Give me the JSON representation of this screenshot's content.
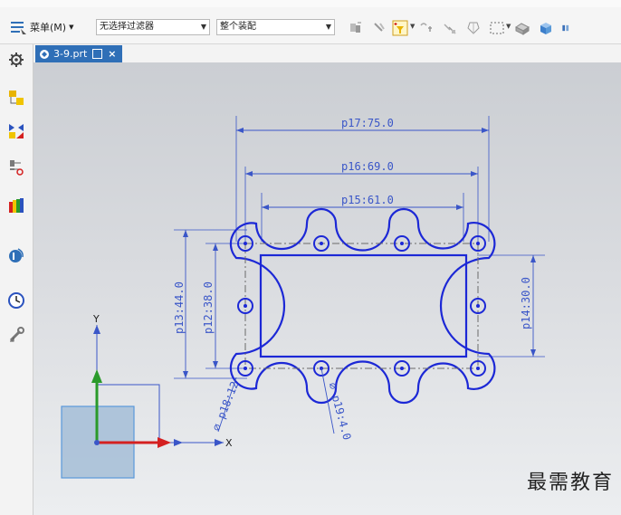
{
  "toolbar": {
    "menu_label": "菜单(M)",
    "filter_value": "无选择过滤器",
    "assembly_value": "整个装配"
  },
  "sidebar": {
    "items": [
      "gear-icon",
      "part-navigator-icon",
      "assembly-navigator-icon",
      "constraint-navigator-icon",
      "reuse-library-icon",
      "web-browser-icon",
      "history-icon",
      "role-icon"
    ]
  },
  "tab": {
    "label": "3-9.prt"
  },
  "drawing": {
    "dims": {
      "p17": "p17:75.0",
      "p16": "p16:69.0",
      "p15": "p15:61.0",
      "p13": "p13:44.0",
      "p12": "p12:38.0",
      "p14": "p14:30.0",
      "p18": "⌀ p18:12",
      "p19": "⌀ p19:4.0"
    },
    "axes": {
      "x": "X",
      "y": "Y"
    },
    "colors": {
      "sketch": "#1c28d6",
      "dimension": "#3a56c8",
      "centerline": "#6a6a6a",
      "x_axis": "#d42020",
      "y_axis": "#2a9a2a"
    }
  },
  "watermark": "最需教育"
}
